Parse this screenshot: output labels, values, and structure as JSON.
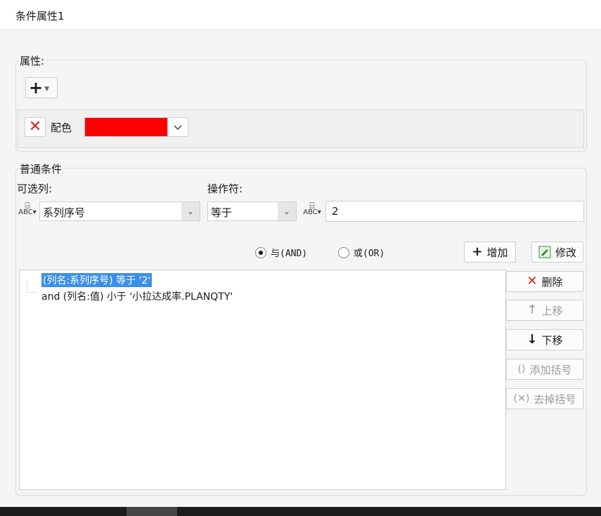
{
  "window": {
    "title": "条件属性1"
  },
  "attributes": {
    "group_label": "属性:",
    "add_icon": "plus-icon",
    "add_dropdown_icon": "caret-down-icon",
    "row": {
      "label": "配色",
      "color": "#ff0000",
      "delete_icon": "close-icon",
      "dropdown_icon": "chevron-down-icon"
    }
  },
  "conditions": {
    "group_label": "普通条件",
    "column_label": "可选列:",
    "operator_label": "操作符:",
    "column_value": "系列序号",
    "operator_value": "等于",
    "value_text": "2",
    "value_type_icon": "abc-type-icon",
    "radio_and": "与(AND)",
    "radio_or": "或(OR)",
    "radio_selected": "and",
    "add_button": "增加",
    "modify_button": "修改",
    "list": [
      {
        "text": "(列名:系列序号) 等于 '2'",
        "selected": true
      },
      {
        "text": "and (列名:值) 小于 '小拉达成率.PLANQTY'",
        "selected": false
      }
    ],
    "side_buttons": {
      "delete": "删除",
      "move_up": "上移",
      "move_down": "下移",
      "add_bracket": "添加括号",
      "remove_bracket": "去掉括号"
    },
    "colors": {
      "selection": "#3c8fe6",
      "delete_red": "#e02020"
    }
  }
}
